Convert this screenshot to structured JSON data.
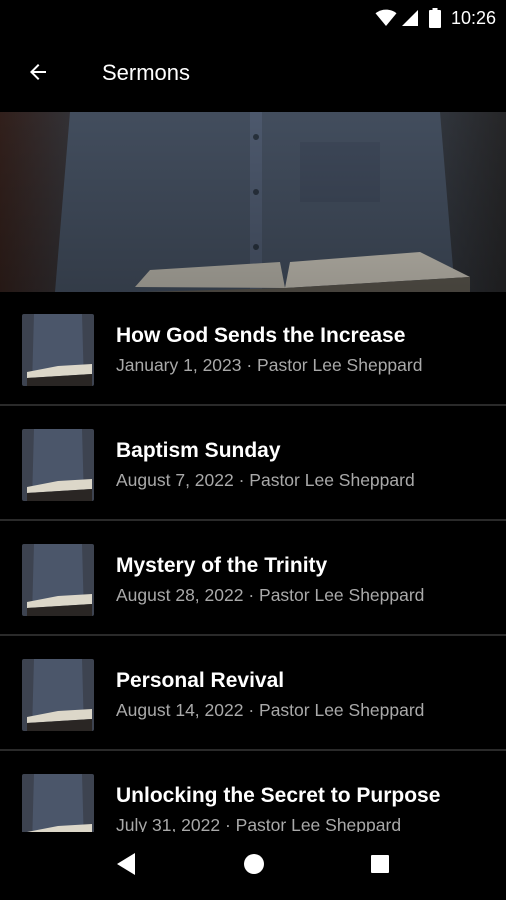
{
  "status_bar": {
    "time": "10:26",
    "icons": [
      "wifi-icon",
      "cellular-signal-icon",
      "battery-icon"
    ]
  },
  "app_bar": {
    "back_icon": "arrow-left-icon",
    "title": "Sermons"
  },
  "sermons": [
    {
      "title": "How God Sends the Increase",
      "meta": "January 1, 2023 · Pastor Lee Sheppard"
    },
    {
      "title": "Baptism Sunday",
      "meta": "August 7, 2022 · Pastor Lee Sheppard"
    },
    {
      "title": "Mystery of the Trinity",
      "meta": "August 28, 2022 · Pastor Lee Sheppard"
    },
    {
      "title": "Personal Revival",
      "meta": "August 14, 2022 · Pastor Lee Sheppard"
    },
    {
      "title": "Unlocking the Secret to Purpose",
      "meta": "July 31, 2022 · Pastor Lee Sheppard"
    }
  ],
  "nav_bar": {
    "buttons": [
      "back-triangle-icon",
      "home-circle-icon",
      "recents-square-icon"
    ]
  },
  "colors": {
    "background": "#000000",
    "text_primary": "#ffffff",
    "text_secondary": "#a9a9a9",
    "divider": "#2a2a2a"
  }
}
